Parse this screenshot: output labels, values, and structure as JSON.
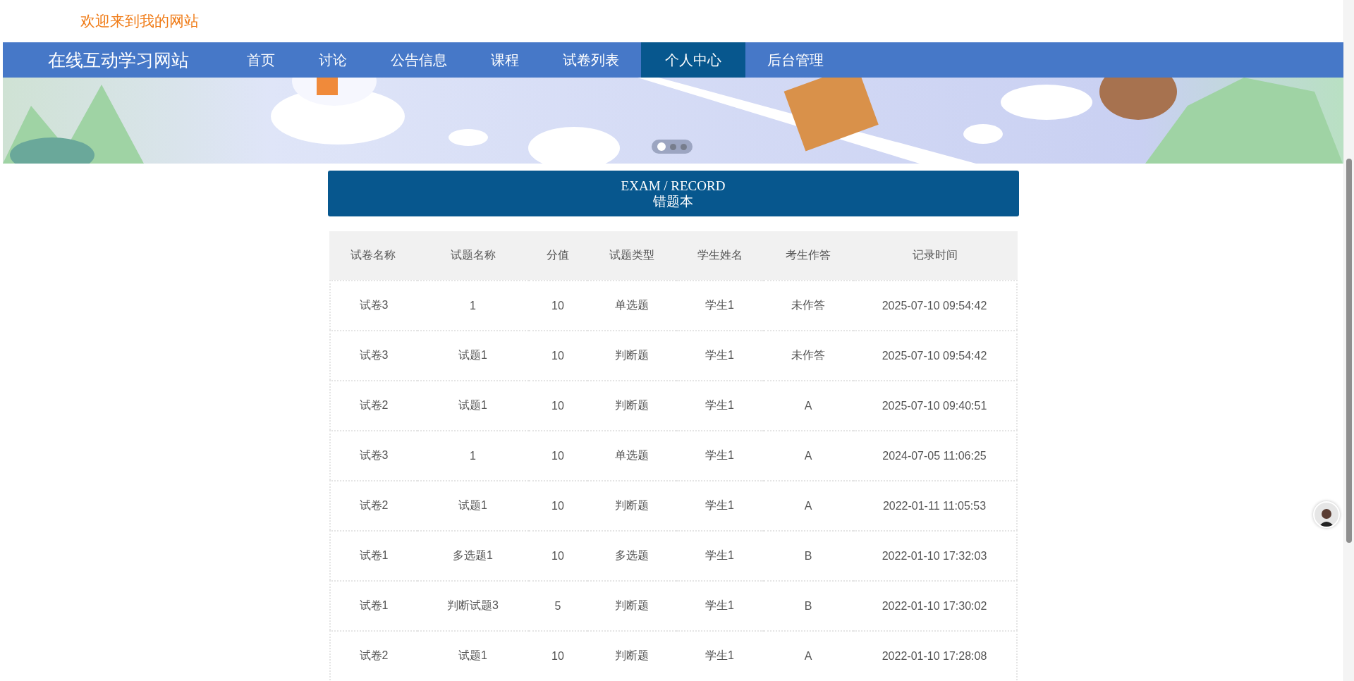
{
  "welcome": "欢迎来到我的网站",
  "brand": "在线互动学习网站",
  "nav": [
    {
      "label": "首页",
      "selected": false
    },
    {
      "label": "讨论",
      "selected": false
    },
    {
      "label": "公告信息",
      "selected": false
    },
    {
      "label": "课程",
      "selected": false
    },
    {
      "label": "试卷列表",
      "selected": false
    },
    {
      "label": "个人中心",
      "selected": true
    },
    {
      "label": "后台管理",
      "selected": false
    }
  ],
  "carousel_dots": [
    {
      "selected": true
    },
    {
      "selected": false
    },
    {
      "selected": false
    }
  ],
  "section": {
    "subtitle": "EXAM / RECORD",
    "title": "错题本"
  },
  "table": {
    "columns": [
      "试卷名称",
      "试题名称",
      "分值",
      "试题类型",
      "学生姓名",
      "考生作答",
      "记录时间"
    ],
    "rows": [
      [
        "试卷3",
        "1",
        "10",
        "单选题",
        "学生1",
        "未作答",
        "2025-07-10 09:54:42"
      ],
      [
        "试卷3",
        "试题1",
        "10",
        "判断题",
        "学生1",
        "未作答",
        "2025-07-10 09:54:42"
      ],
      [
        "试卷2",
        "试题1",
        "10",
        "判断题",
        "学生1",
        "A",
        "2025-07-10 09:40:51"
      ],
      [
        "试卷3",
        "1",
        "10",
        "单选题",
        "学生1",
        "A",
        "2024-07-05 11:06:25"
      ],
      [
        "试卷2",
        "试题1",
        "10",
        "判断题",
        "学生1",
        "A",
        "2022-01-11 11:05:53"
      ],
      [
        "试卷1",
        "多选题1",
        "10",
        "多选题",
        "学生1",
        "B",
        "2022-01-10 17:32:03"
      ],
      [
        "试卷1",
        "判断试题3",
        "5",
        "判断题",
        "学生1",
        "B",
        "2022-01-10 17:30:02"
      ],
      [
        "试卷2",
        "试题1",
        "10",
        "判断题",
        "学生1",
        "A",
        "2022-01-10 17:28:08"
      ]
    ]
  }
}
